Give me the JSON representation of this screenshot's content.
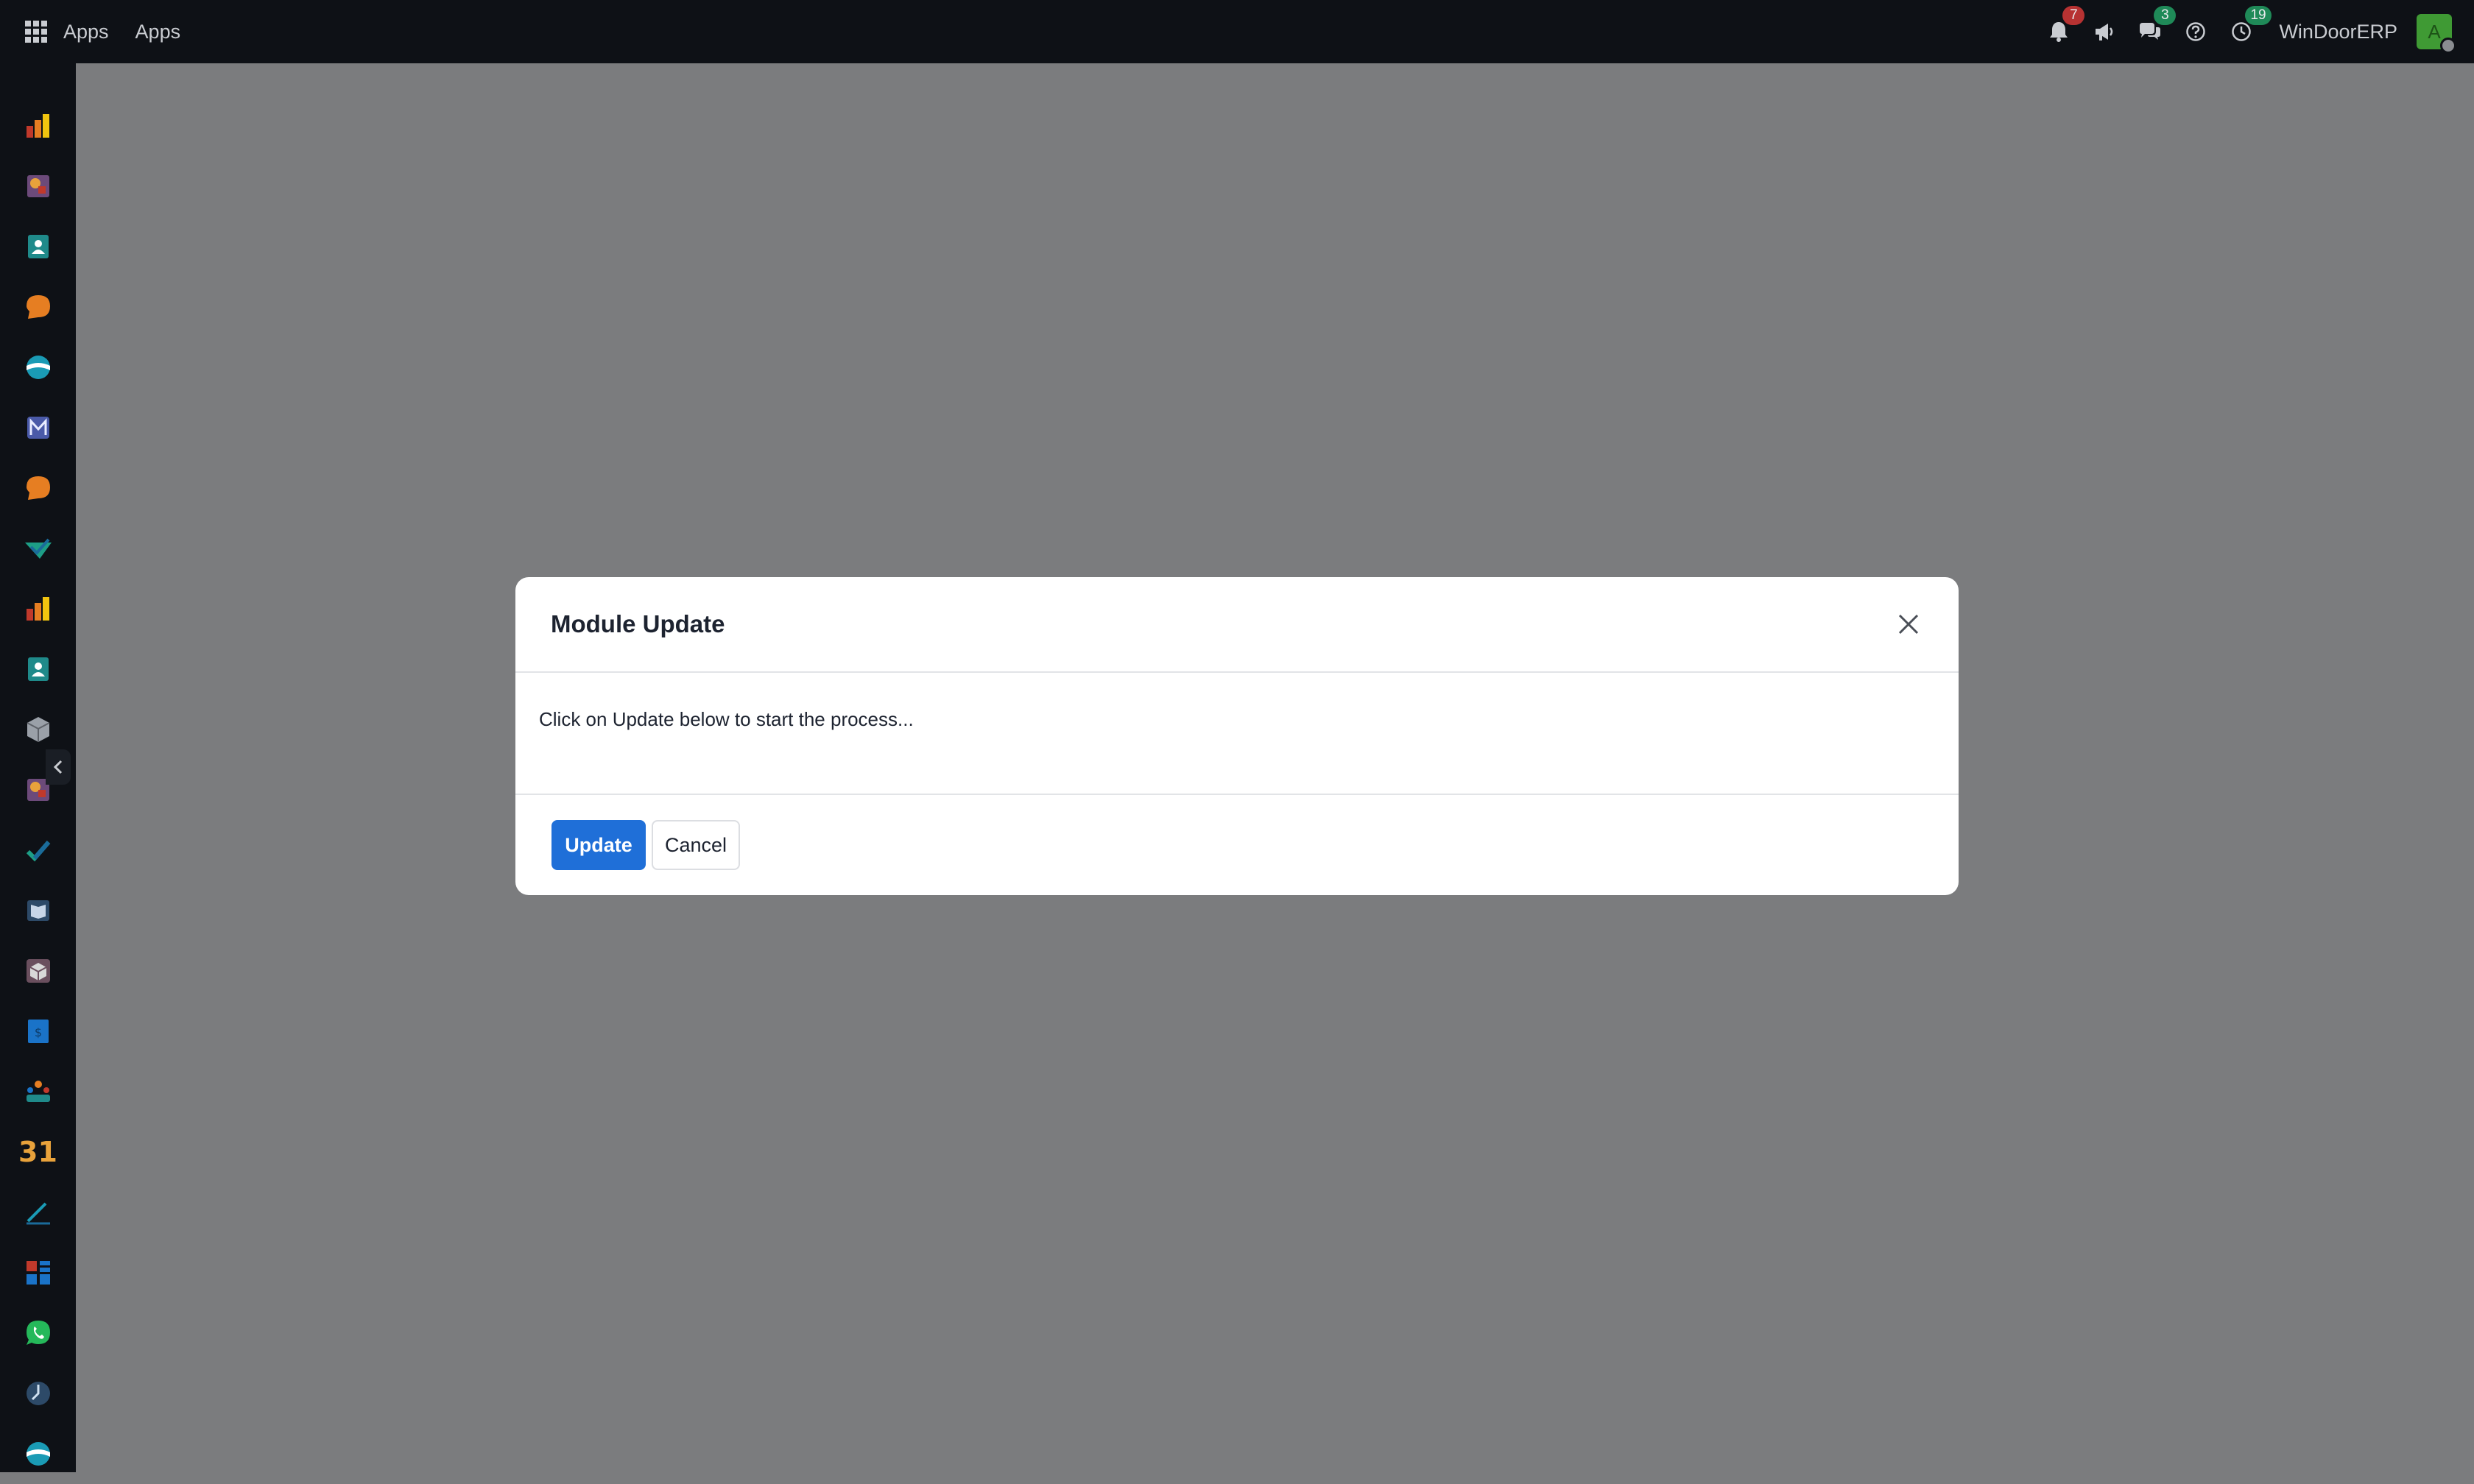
{
  "topbar": {
    "brand": "Apps",
    "menu_apps": "Apps",
    "notifications_count": "7",
    "messages_count": "3",
    "activities_count": "19",
    "company": "WinDoorERP",
    "avatar_initial": "A"
  },
  "sidebar": {
    "icons": [
      "dashboard-bars-icon",
      "puzzle-app-icon",
      "contacts-icon",
      "discuss-bubble-icon",
      "website-wave-icon",
      "email-marketing-icon",
      "live-chat-bubble-icon",
      "documents-check-icon",
      "reports-bars-icon",
      "employees-icon",
      "inventory-box-icon",
      "apps-puzzle-icon",
      "project-check-icon",
      "knowledge-book-icon",
      "product-cube-icon",
      "invoicing-icon",
      "team-icon",
      "calendar-31-icon",
      "sign-pen-icon",
      "dashboard-grid-icon",
      "whatsapp-icon",
      "time-off-icon",
      "website-wave-icon-2"
    ],
    "calendar_day": "31"
  },
  "modal": {
    "title": "Module Update",
    "body_text": "Click on Update below to start the process...",
    "update_label": "Update",
    "cancel_label": "Cancel"
  },
  "colors": {
    "navbar_bg": "#0e1116",
    "backdrop": "#7b7c7e",
    "primary_button": "#1f6fd8",
    "badge_red": "#b73232",
    "badge_green": "#1f8a58",
    "avatar_green": "#3f9a34"
  }
}
